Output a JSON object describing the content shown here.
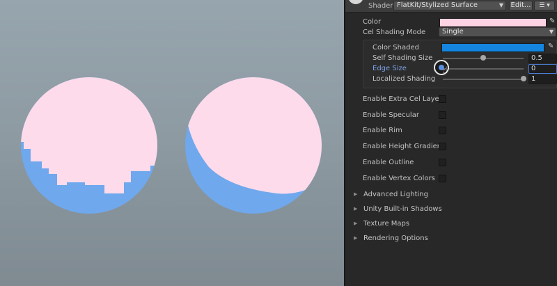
{
  "colors": {
    "viewport_bg": "#8f9ca4",
    "sphere_light": "#fddbeb",
    "sphere_shade": "#6fa8ec",
    "panel_bg": "#282828",
    "color_swatch": "#fbd3e3",
    "shaded_swatch": "#1486e0",
    "accent_label": "#7ca3e8"
  },
  "header": {
    "shader_label": "Shader",
    "shader_value": "FlatKit/Stylized Surface",
    "edit_label": "Edit...",
    "menu_icon": "list-menu-icon"
  },
  "properties": {
    "color_label": "Color",
    "cel_mode_label": "Cel Shading Mode",
    "cel_mode_value": "Single",
    "color_shaded_label": "Color Shaded",
    "self_shading_label": "Self Shading Size",
    "self_shading_value": "0.5",
    "self_shading_fraction": 0.5,
    "edge_size_label": "Edge Size",
    "edge_size_value": "0",
    "edge_size_fraction": 0,
    "localized_label": "Localized Shading",
    "localized_value": "1",
    "localized_fraction": 1
  },
  "toggles": [
    {
      "label": "Enable Extra Cel Layer",
      "checked": false
    },
    {
      "label": "Enable Specular",
      "checked": false
    },
    {
      "label": "Enable Rim",
      "checked": false
    },
    {
      "label": "Enable Height Gradient",
      "checked": false
    },
    {
      "label": "Enable Outline",
      "checked": false
    },
    {
      "label": "Enable Vertex Colors",
      "checked": false
    }
  ],
  "foldouts": [
    {
      "label": "Advanced Lighting"
    },
    {
      "label": "Unity Built-in Shadows"
    },
    {
      "label": "Texture Maps"
    },
    {
      "label": "Rendering Options"
    }
  ]
}
